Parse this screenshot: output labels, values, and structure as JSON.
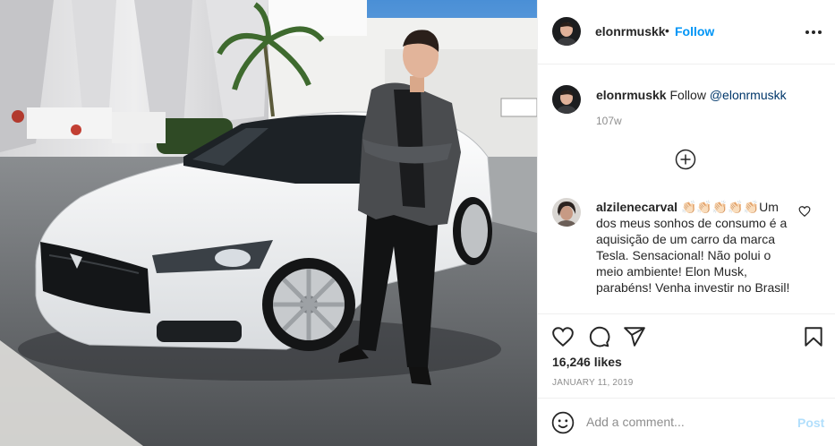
{
  "post": {
    "username": "elonrmuskk",
    "separator": "•",
    "follow_label": "Follow",
    "more_icon": "more-horizontal-icon",
    "caption": {
      "username": "elonrmuskk",
      "text_before": "Follow ",
      "mention": "@elonrmuskk",
      "time": "107w"
    },
    "load_more_icon": "plus-circle-icon"
  },
  "comments": [
    {
      "username": "alzilenecarval",
      "emoji": "👏🏻👏🏻👏🏻👏🏻👏🏻",
      "text": "Um dos meus sonhos de consumo é a aquisição de um carro da marca Tesla. Sensacional! Não polui o meio ambiente! Elon Musk, parabéns! Venha investir no Brasil!"
    }
  ],
  "actions": {
    "like_icon": "heart-icon",
    "comment_icon": "comment-icon",
    "share_icon": "share-icon",
    "save_icon": "bookmark-icon"
  },
  "likes": "16,246 likes",
  "date": "JANUARY 11, 2019",
  "add_comment": {
    "placeholder": "Add a comment...",
    "post_label": "Post",
    "emoji_icon": "smiley-icon"
  },
  "colors": {
    "accent": "#0095f6",
    "muted": "#8e8e8e",
    "post_disabled": "#b2dffc",
    "text": "#262626"
  }
}
